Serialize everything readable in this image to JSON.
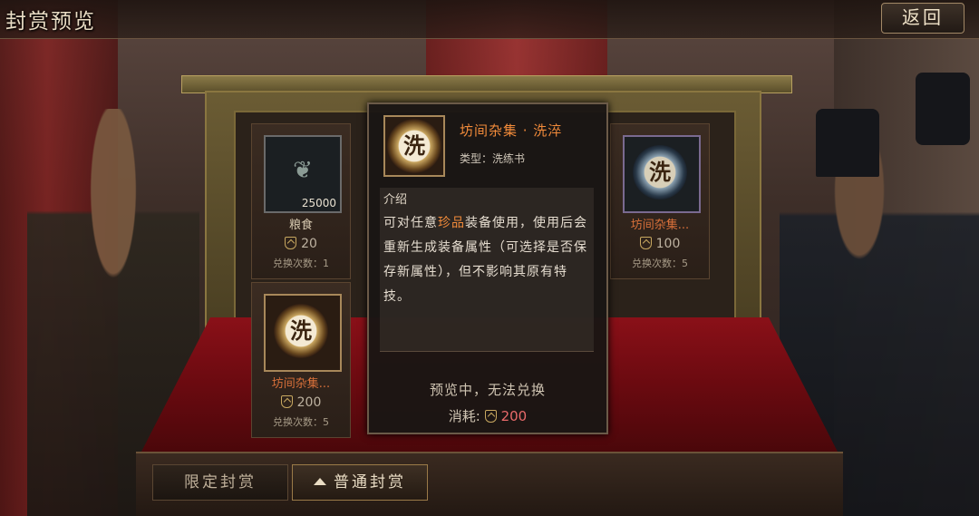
{
  "header": {
    "title": "封赏预览",
    "back_label": "返回"
  },
  "items": [
    {
      "name": "粮食",
      "quantity": "25000",
      "cost": "20",
      "times_label": "兑换次数：1",
      "icon": "grain-icon"
    },
    {
      "name": "坊间杂集...",
      "cost": "100",
      "times_label": "兑换次数：5",
      "icon": "wash-coin-blue-icon"
    },
    {
      "name": "坊间杂集...",
      "cost": "200",
      "times_label": "兑换次数：5",
      "icon": "wash-coin-icon"
    }
  ],
  "tooltip": {
    "icon_glyph": "洗",
    "title": "坊间杂集 · 洗淬",
    "type_label": "类型：洗练书",
    "intro_heading": "介绍",
    "desc_before": "可对任意",
    "desc_highlight": "珍品",
    "desc_after": "装备使用，使用后会重新生成装备属性（可选择是否保存新属性），但不影响其原有特技。",
    "status": "预览中，无法兑换",
    "cost_label": "消耗:",
    "cost_value": "200"
  },
  "tabs": [
    {
      "label": "限定封赏",
      "active": false
    },
    {
      "label": "普通封赏",
      "active": true
    }
  ],
  "colors": {
    "highlight": "#f08a3a",
    "cost_red": "#e86a6a"
  }
}
